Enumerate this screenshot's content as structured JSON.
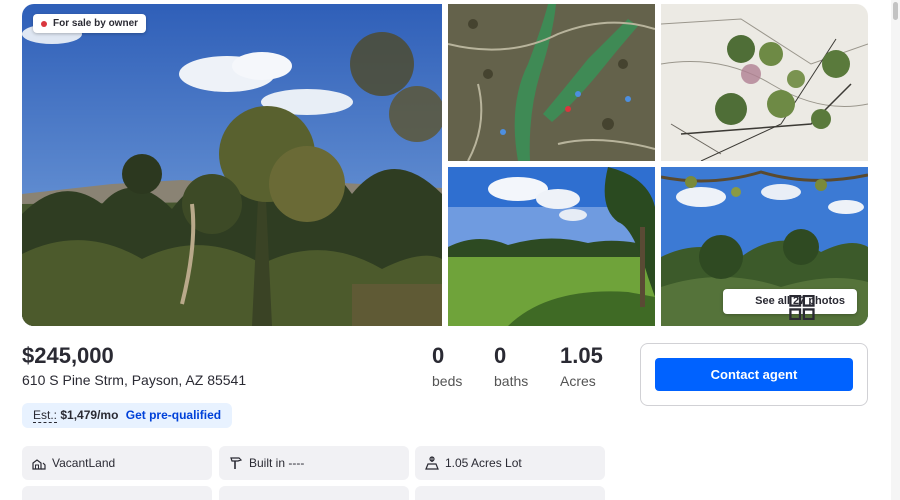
{
  "listing": {
    "sale_badge": "For sale by owner",
    "see_all_label": "See all 27 photos",
    "price": "$245,000",
    "address": "610 S Pine Strm, Payson, AZ 85541",
    "stats": {
      "beds_value": "0",
      "beds_label": "beds",
      "baths_value": "0",
      "baths_label": "baths",
      "acres_value": "1.05",
      "acres_label": "Acres"
    },
    "estimate": {
      "label": "Est.:",
      "value": "$1,479/mo",
      "link": "Get pre-qualified"
    },
    "facts": [
      {
        "label": "VacantLand",
        "icon": "land-icon"
      },
      {
        "label": "Built in ----",
        "icon": "hammer-icon"
      },
      {
        "label": "1.05 Acres Lot",
        "icon": "lot-icon"
      }
    ]
  },
  "contact": {
    "button_label": "Contact agent"
  },
  "colors": {
    "primary": "#0062ff",
    "link": "#0041d9",
    "estimate_bg": "#e8f2ff",
    "badge_dot": "#d9363e"
  }
}
